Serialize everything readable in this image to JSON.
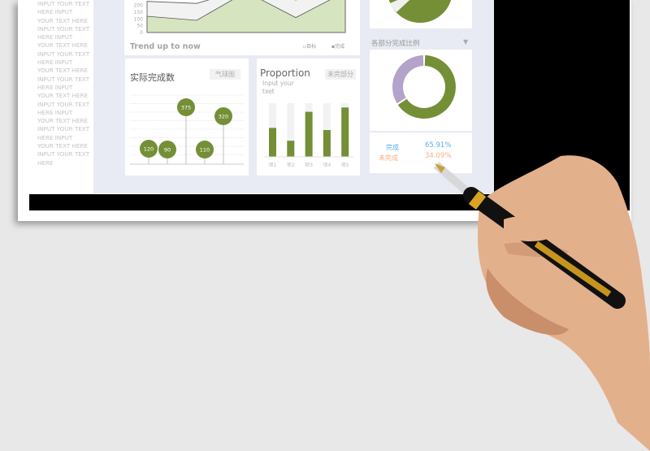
{
  "sidebar": {
    "lines": [
      "INPUT YOUR TEXT",
      "HERE INPUT",
      "YOUR TEXT HERE",
      "INPUT YOUR TEXT",
      "HERE INPUT",
      "YOUR TEXT HERE",
      "INPUT YOUR TEXT",
      "HERE INPUT",
      "YOUR TEXT HERE",
      "INPUT YOUR TEXT",
      "HERE INPUT",
      "YOUR TEXT HERE",
      "INPUT YOUR TEXT",
      "HERE INPUT",
      "YOUR TEXT HERE",
      "INPUT YOUR TEXT",
      "HERE INPUT",
      "YOUR TEXT HERE",
      "INPUT YOUR TEXT",
      "HERE"
    ]
  },
  "trend": {
    "title": "Trend up to now",
    "legend": [
      "目标",
      "完成"
    ],
    "chart_data": {
      "type": "area",
      "y_ticks": [
        0,
        50,
        100,
        150,
        200
      ],
      "ylim": [
        0,
        240
      ],
      "series": [
        {
          "name": "目标",
          "values": [
            230,
            215,
            320,
            240,
            320
          ],
          "color": "#f2f2f2"
        },
        {
          "name": "完成",
          "values": [
            120,
            90,
            300,
            110,
            300
          ],
          "color": "#d6e4bf"
        }
      ]
    }
  },
  "balloon": {
    "title": "实际完成数",
    "tag": "气球图",
    "chart_data": {
      "type": "scatter",
      "values": [
        120,
        90,
        375,
        110,
        320
      ],
      "color": "#748f36"
    }
  },
  "proportion": {
    "title": "Proportion",
    "subtitle": "Input your txet",
    "tag": "未完部分",
    "chart_data": {
      "type": "bar",
      "categories": [
        "项1",
        "项2",
        "项3",
        "项4",
        "项5"
      ],
      "values": [
        0.54,
        0.3,
        0.84,
        0.5,
        0.92
      ],
      "ylim": [
        0,
        1
      ]
    }
  },
  "ratio": {
    "title": "各部分完成比例",
    "dropdown_icon": "triangle-down",
    "chart_data": {
      "type": "pie",
      "categories": [
        "完成",
        "未完成"
      ],
      "values": [
        65.91,
        34.09
      ],
      "colors": [
        "#748f36",
        "#b3a2c9"
      ]
    },
    "rows": [
      {
        "label": "完成",
        "value": "65.91%",
        "color": "#5aaef0"
      },
      {
        "label": "未完成",
        "value": "34.09%",
        "color": "#f5b183"
      }
    ]
  }
}
